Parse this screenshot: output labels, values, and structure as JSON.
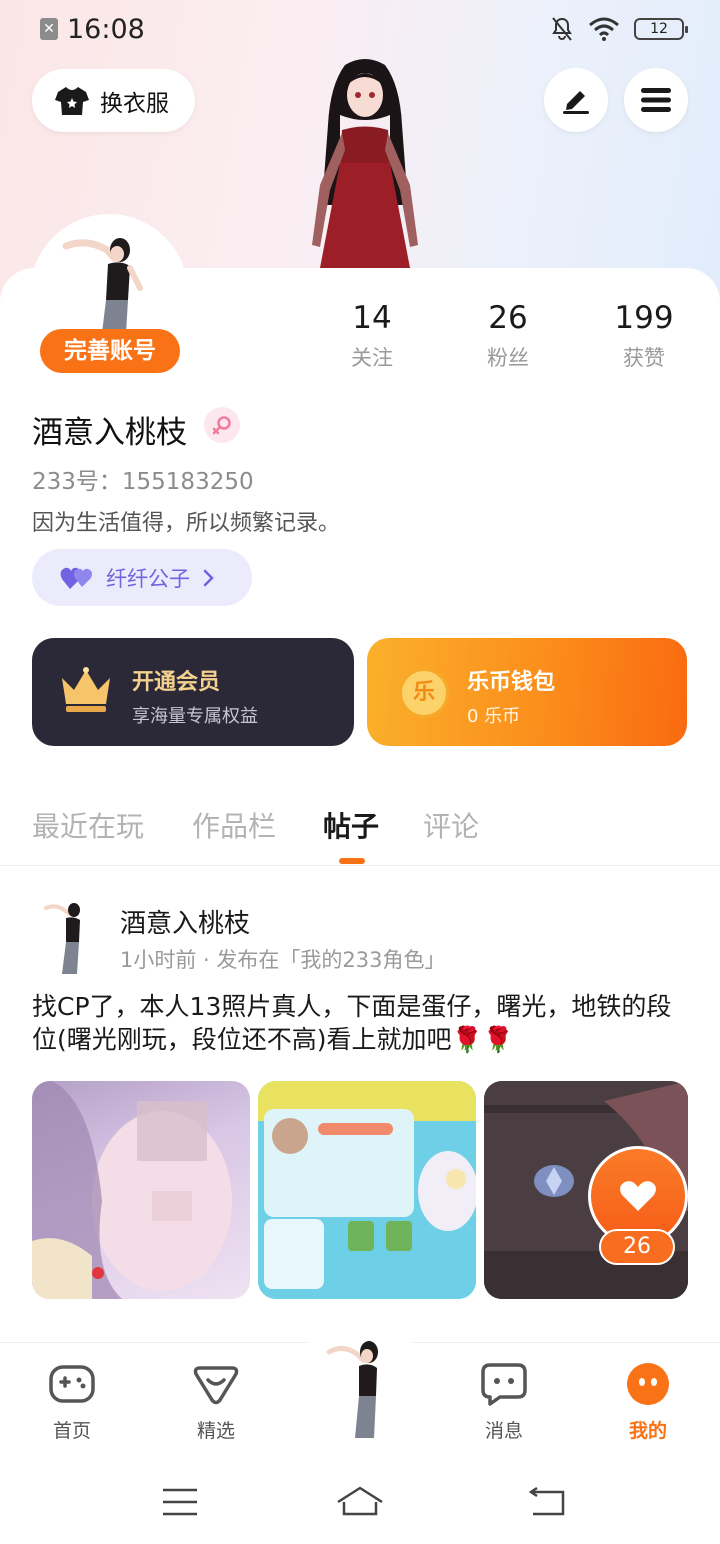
{
  "status_bar": {
    "time": "16:08",
    "battery": "12"
  },
  "header": {
    "outfit_label": "换衣服"
  },
  "profile": {
    "complete_label": "完善账号",
    "stats": [
      {
        "value": "14",
        "label": "关注"
      },
      {
        "value": "26",
        "label": "粉丝"
      },
      {
        "value": "199",
        "label": "获赞"
      }
    ],
    "name": "酒意入桃枝",
    "id_line": "233号：155183250",
    "bio": "因为生活值得，所以频繁记录。",
    "club": "纤纤公子"
  },
  "cards": {
    "vip_title": "开通会员",
    "vip_sub": "享海量专属权益",
    "coin_title": "乐币钱包",
    "coin_sub": "0 乐币",
    "coin_glyph": "乐"
  },
  "tabs": [
    {
      "label": "最近在玩"
    },
    {
      "label": "作品栏"
    },
    {
      "label": "帖子"
    },
    {
      "label": "评论"
    }
  ],
  "post": {
    "author": "酒意入桃枝",
    "meta": "1小时前 · 发布在「我的233角色」",
    "text": "找CP了，本人13照片真人，下面是蛋仔，曙光，地铁的段位(曙光刚玩，段位还不高)看上就加吧🌹🌹",
    "like_count": "26"
  },
  "bottom_nav": [
    {
      "label": "首页"
    },
    {
      "label": "精选"
    },
    {
      "label": "消息"
    },
    {
      "label": "我的"
    }
  ],
  "colors": {
    "accent": "#f97316",
    "vip_bg": "#2b2838",
    "club_text": "#6f63e2"
  }
}
